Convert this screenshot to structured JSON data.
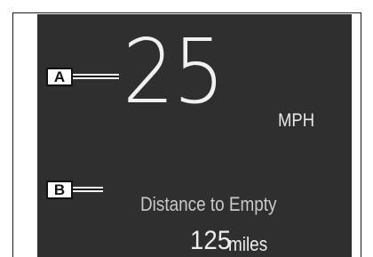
{
  "speedometer": {
    "speed": "25",
    "unit": "MPH"
  },
  "distance_to_empty": {
    "label": "Distance to Empty",
    "value": "125",
    "unit": "miles"
  },
  "callouts": {
    "a": "A",
    "b": "B"
  },
  "colors": {
    "display_background": "#2f2f2f",
    "primary_text": "#f1f1f1",
    "secondary_text": "#c9c9c9"
  }
}
